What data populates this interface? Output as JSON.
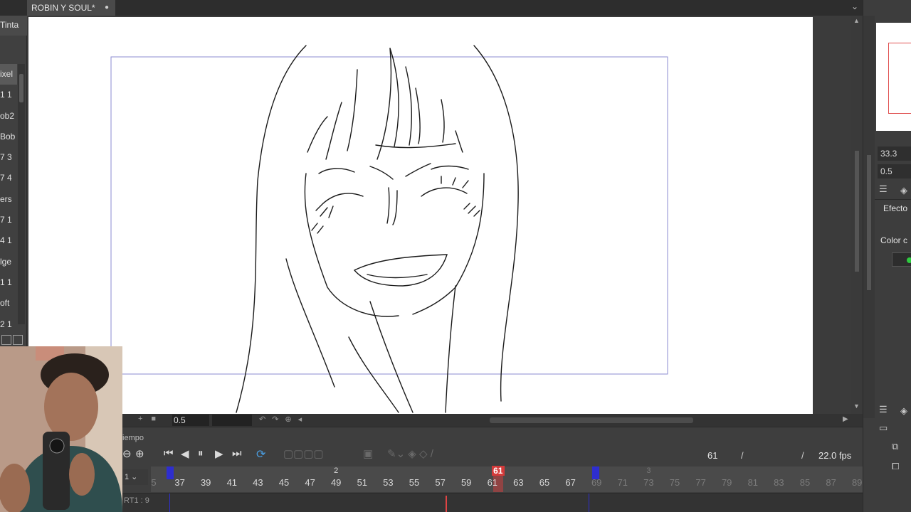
{
  "document": {
    "tab_title": "ROBIN Y SOUL*",
    "modified_dot": "●"
  },
  "left_panel": {
    "tool_label": "Tinta",
    "items": [
      "ixel",
      "1 1",
      "ob2",
      "Bob",
      "7 3",
      "7 4",
      "ers",
      "7 1",
      "4 1",
      "lge",
      "1 1",
      "oft",
      "2 1"
    ]
  },
  "canvas_toolbar": {
    "zoom": "0.5"
  },
  "timeline": {
    "panel_title": "iempo",
    "current_frame": "61",
    "slash": "/",
    "fps": "22.0 fps",
    "layer_selector": "1",
    "track_name": "RT1 : 9",
    "ruler_numbers": [
      {
        "label": "5",
        "dim": true
      },
      {
        "label": "37",
        "dim": false
      },
      {
        "label": "39",
        "dim": false
      },
      {
        "label": "41",
        "dim": false
      },
      {
        "label": "43",
        "dim": false
      },
      {
        "label": "45",
        "dim": false
      },
      {
        "label": "47",
        "dim": false
      },
      {
        "label": "49",
        "dim": false
      },
      {
        "label": "51",
        "dim": false
      },
      {
        "label": "53",
        "dim": false
      },
      {
        "label": "55",
        "dim": false
      },
      {
        "label": "57",
        "dim": false
      },
      {
        "label": "59",
        "dim": false
      },
      {
        "label": "61",
        "dim": false
      },
      {
        "label": "63",
        "dim": false
      },
      {
        "label": "65",
        "dim": false
      },
      {
        "label": "67",
        "dim": false
      },
      {
        "label": "69",
        "dim": true
      },
      {
        "label": "71",
        "dim": true
      },
      {
        "label": "73",
        "dim": true
      },
      {
        "label": "75",
        "dim": true
      },
      {
        "label": "77",
        "dim": true
      },
      {
        "label": "79",
        "dim": true
      },
      {
        "label": "81",
        "dim": true
      },
      {
        "label": "83",
        "dim": true
      },
      {
        "label": "85",
        "dim": true
      },
      {
        "label": "87",
        "dim": true
      },
      {
        "label": "89",
        "dim": true
      }
    ],
    "keyframes": [
      {
        "label": "2",
        "dim": false
      },
      {
        "label": "3",
        "dim": true
      }
    ],
    "playhead_label": "61"
  },
  "right_panel": {
    "value_1": "33.3",
    "value_2": "0.5",
    "label_effect": "Efecto",
    "label_color": "Color c"
  },
  "colors": {
    "accent_blue": "#4a9de0",
    "playhead_red": "#d43a3a",
    "range_blue": "#2e2ecf",
    "nav_frame": "#e05050"
  }
}
